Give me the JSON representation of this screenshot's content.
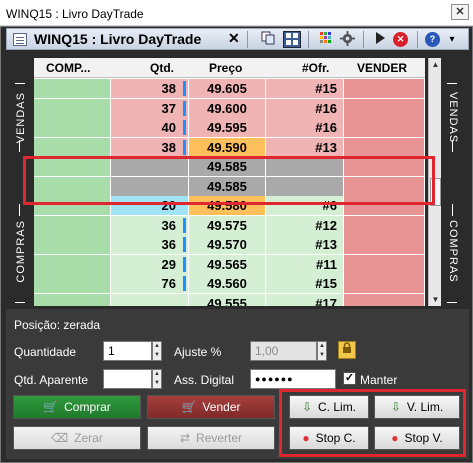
{
  "window": {
    "title": "WINQ15 : Livro DayTrade",
    "close_label": "✕"
  },
  "tab": {
    "title": "WINQ15 : Livro DayTrade",
    "close_label": "✕"
  },
  "toolbar": {
    "help_label": "?",
    "menu_label": "▾"
  },
  "book": {
    "headers": {
      "comp": "COMP...",
      "qtd": "Qtd.",
      "preco": "Preço",
      "ofr": "#Ofr.",
      "vender": "VENDER"
    },
    "side_left_top": "VENDAS",
    "side_left_bottom": "COMPRAS",
    "side_right_top": "VENDAS",
    "side_right_bottom": "COMPRAS",
    "rows": [
      {
        "qtd": "38",
        "preco": "49.605",
        "ofr": "#15",
        "kind": "sell"
      },
      {
        "qtd": "37",
        "preco": "49.600",
        "ofr": "#16",
        "kind": "sell"
      },
      {
        "qtd": "40",
        "preco": "49.595",
        "ofr": "#16",
        "kind": "sell"
      },
      {
        "qtd": "38",
        "preco": "49.590",
        "ofr": "#13",
        "kind": "sell-best"
      },
      {
        "qtd": "",
        "preco": "49.585",
        "ofr": "",
        "kind": "spread"
      },
      {
        "qtd": "",
        "preco": "49.585",
        "ofr": "",
        "kind": "spread"
      },
      {
        "qtd": "20",
        "preco": "49.580",
        "ofr": "#6",
        "kind": "buy-best"
      },
      {
        "qtd": "36",
        "preco": "49.575",
        "ofr": "#12",
        "kind": "buy"
      },
      {
        "qtd": "36",
        "preco": "49.570",
        "ofr": "#13",
        "kind": "buy"
      },
      {
        "qtd": "29",
        "preco": "49.565",
        "ofr": "#11",
        "kind": "buy"
      },
      {
        "qtd": "76",
        "preco": "49.560",
        "ofr": "#15",
        "kind": "buy"
      },
      {
        "qtd": "",
        "preco": "49.555",
        "ofr": "#17",
        "kind": "buy"
      }
    ]
  },
  "form": {
    "posicao": "Posição: zerada",
    "quantidade_label": "Quantidade",
    "quantidade_value": "1",
    "ajuste_label": "Ajuste %",
    "ajuste_value": "1,00",
    "qtd_aparente_label": "Qtd. Aparente",
    "qtd_aparente_value": "",
    "ass_digital_label": "Ass. Digital",
    "ass_digital_value": "●●●●●●",
    "manter_label": "Manter",
    "manter_checked": "✓"
  },
  "buttons": {
    "comprar": "Comprar",
    "vender": "Vender",
    "zerar": "Zerar",
    "reverter": "Reverter",
    "c_lim": "C. Lim.",
    "v_lim": "V. Lim.",
    "stop_c": "Stop C.",
    "stop_v": "Stop V."
  },
  "colors": {
    "buy_cell": "#d4efd4",
    "buy_comp": "#a8dca8",
    "sell_cell": "#f0b4b4",
    "sell_vend": "#e89494",
    "best_sell_price": "#ffbf5a",
    "best_buy_qtd": "#9fe3f5",
    "spread": "#a9a9a9",
    "highlight": "#e0262f"
  }
}
